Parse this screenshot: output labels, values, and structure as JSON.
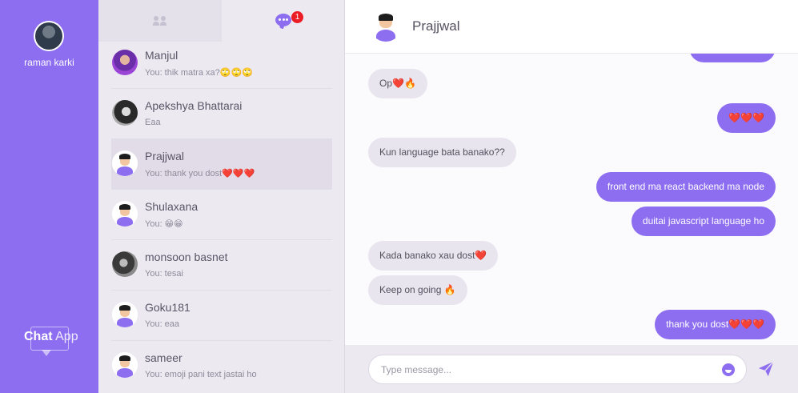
{
  "user": {
    "name": "raman karki"
  },
  "brand": {
    "bold": "Chat",
    "rest": "App"
  },
  "tabs": {
    "chats_badge": "1"
  },
  "conversations": [
    {
      "name": "Manjul",
      "last_message": "You: thik matra xa?🙄🙄🙄",
      "avatar": "photo"
    },
    {
      "name": "Apekshya Bhattarai",
      "last_message": "Eaa",
      "avatar": "photo"
    },
    {
      "name": "Prajjwal",
      "last_message": "You: thank you dost❤️❤️❤️",
      "avatar": "cartoon",
      "active": true
    },
    {
      "name": "Shulaxana",
      "last_message": "You: 😁😁",
      "avatar": "cartoon"
    },
    {
      "name": "monsoon basnet",
      "last_message": "You: tesai",
      "avatar": "photo"
    },
    {
      "name": "Goku181",
      "last_message": "You: eaa",
      "avatar": "cartoon"
    },
    {
      "name": "sameer",
      "last_message": "You: emoji pani text jastai ho",
      "avatar": "cartoon"
    }
  ],
  "chat": {
    "title": "Prajjwal",
    "messages": [
      {
        "dir": "in",
        "text": "Op❤️🔥"
      },
      {
        "dir": "out",
        "text": "❤️❤️❤️"
      },
      {
        "dir": "in",
        "text": "Kun language bata banako??"
      },
      {
        "dir": "out",
        "text": "front end ma react backend ma node"
      },
      {
        "dir": "out",
        "text": "duitai javascript language ho"
      },
      {
        "dir": "in",
        "text": "Kada banako xau dost❤️"
      },
      {
        "dir": "in",
        "text": "Keep on going 🔥"
      },
      {
        "dir": "out",
        "text": "thank you dost❤️❤️❤️"
      }
    ]
  },
  "composer": {
    "placeholder": "Type message..."
  },
  "colors": {
    "accent": "#8d6ef0",
    "badge": "#ec1c24"
  }
}
